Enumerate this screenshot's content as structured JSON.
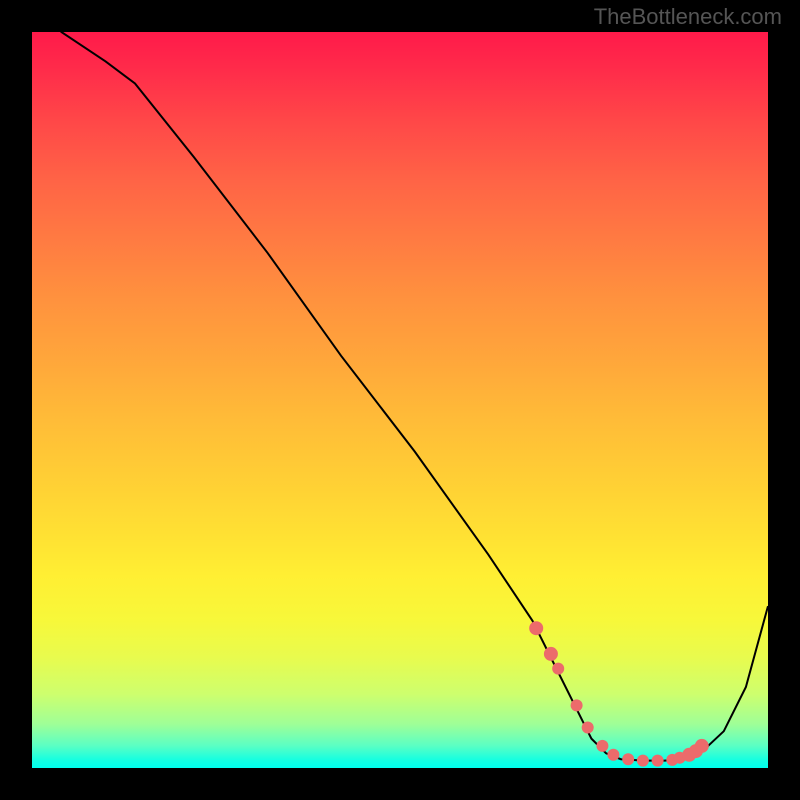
{
  "watermark": "TheBottleneck.com",
  "chart_data": {
    "type": "line",
    "title": "",
    "xlabel": "",
    "ylabel": "",
    "xlim": [
      0,
      100
    ],
    "ylim": [
      0,
      100
    ],
    "series": [
      {
        "name": "main-curve",
        "x": [
          0,
          4,
          10,
          14,
          22,
          32,
          42,
          52,
          62,
          68,
          71,
          74,
          76,
          78,
          80,
          83,
          86,
          89,
          91,
          94,
          97,
          100
        ],
        "y": [
          105,
          100,
          96,
          93,
          83,
          70,
          56,
          43,
          29,
          20,
          14,
          8,
          4,
          2,
          1.2,
          1,
          1,
          1.3,
          2.2,
          5,
          11,
          22
        ]
      }
    ],
    "highlight_points": {
      "name": "hotspots",
      "color": "#ec6b6b",
      "x": [
        68.5,
        70.5,
        71.5,
        74,
        75.5,
        77.5,
        79,
        81,
        83,
        85,
        87,
        88,
        89.3,
        90.2,
        91
      ],
      "y": [
        19,
        15.5,
        13.5,
        8.5,
        5.5,
        3,
        1.8,
        1.2,
        1,
        1,
        1.1,
        1.4,
        1.8,
        2.3,
        3
      ]
    }
  }
}
